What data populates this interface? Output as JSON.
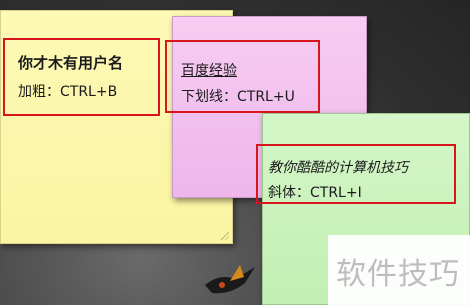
{
  "notes": [
    {
      "color": "#fbf4a2",
      "title": "你才木有用户名",
      "subtitle": "加粗：CTRL+B",
      "style": "bold"
    },
    {
      "color": "#eeb6ea",
      "title": "百度经验",
      "subtitle": "下划线：CTRL+U",
      "style": "underline"
    },
    {
      "color": "#c3efb3",
      "title": "教你酷酷的计算机技巧",
      "subtitle": "斜体：CTRL+I",
      "style": "italic"
    }
  ],
  "highlight_color": "#d8141c",
  "watermark": {
    "text": "软件技巧"
  }
}
